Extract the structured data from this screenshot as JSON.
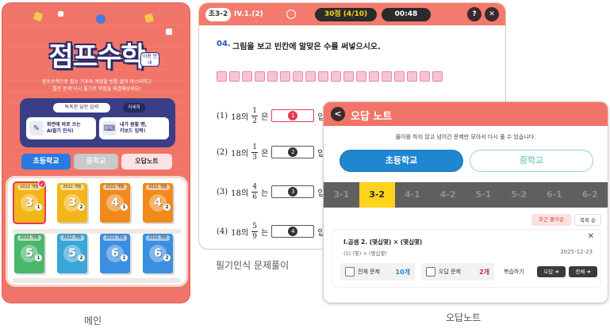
{
  "main": {
    "logo_text": "점프수학",
    "logo_badge": "이용 안내",
    "intro_line1": "점프수학으로 필수 기초와 개념을 빈틈 없이 마스터하고",
    "intro_line2": "틀린 문제 다시 풀기로 약점을 해결해보세요!",
    "input_title": "똑똑한 답안 입력",
    "detail_label": "자세히",
    "features": [
      {
        "line1": "화면에 바로 쓰는",
        "line2": "AI필기 인식!"
      },
      {
        "line1": "내가 원할 땐,",
        "line2": "키보드 입력!"
      }
    ],
    "tabs": {
      "elementary": "초등학교",
      "middle": "중학교",
      "wrong_note": "오답노트"
    },
    "books": [
      {
        "year": "2022 개정",
        "grade": "3",
        "sem": "1",
        "color": "#f2b619"
      },
      {
        "year": "2022 개정",
        "grade": "3",
        "sem": "2",
        "color": "#f2b619"
      },
      {
        "year": "2022 개정",
        "grade": "4",
        "sem": "1",
        "color": "#f08a1c"
      },
      {
        "year": "2022 개정",
        "grade": "4",
        "sem": "2",
        "color": "#f08a1c"
      },
      {
        "year": "2022 개정",
        "grade": "5",
        "sem": "1",
        "color": "#49b86a"
      },
      {
        "year": "2022 개정",
        "grade": "5",
        "sem": "2",
        "color": "#3aa6d8"
      },
      {
        "year": "2022 개정",
        "grade": "6",
        "sem": "1",
        "color": "#3a8fe0"
      },
      {
        "year": "2022 개정",
        "grade": "6",
        "sem": "2",
        "color": "#3a8fe0"
      }
    ],
    "caption": "메인"
  },
  "quiz": {
    "grade_chip": "초3-2",
    "unit_chip": "IV.1.(2)",
    "score_label": "30점 (4/10)",
    "timer": "00:48",
    "help_icon": "?",
    "close_icon": "✕",
    "question_number": "04.",
    "question_text": "그림을 보고 빈칸에 알맞은 수를 써넣으시오.",
    "rows": [
      {
        "label": "(1)",
        "base": "18의",
        "num": "1",
        "den": "2",
        "particle": "은",
        "box": "1",
        "trail": "입"
      },
      {
        "label": "(2)",
        "base": "18의",
        "num": "1",
        "den": "3",
        "particle": "은",
        "box": "2",
        "trail": "입"
      },
      {
        "label": "(3)",
        "base": "18의",
        "num": "4",
        "den": "6",
        "particle": "는",
        "box": "3",
        "trail": "입"
      },
      {
        "label": "(4)",
        "base": "18의",
        "num": "5",
        "den": "9",
        "particle": "는",
        "box": "4",
        "trail": "입"
      }
    ],
    "caption": "필기인식 문제풀이"
  },
  "note": {
    "back_icon": "<",
    "title": "오답 노트",
    "subtitle": "풀이를 하지 않고 넘어간 문제만 모아서 다시 풀 수 있습니다.",
    "seg_elementary": "초등학교",
    "seg_middle": "중학교",
    "grades": [
      "3-1",
      "3-2",
      "4-1",
      "4-2",
      "5-1",
      "5-2",
      "6-1",
      "6-2"
    ],
    "selected_grade": "3-2",
    "sort_recent": "최근 풀이순",
    "sort_wrong": "목록 순",
    "card": {
      "title": "Ⅰ.곱셈   2. (몇십몇) × (몇십몇)",
      "sub": "(5) (몇) × (몇십몇)",
      "date": "2025-12-23",
      "close": "✕",
      "total_label": "전체 문제",
      "total_value": "10개",
      "wrong_label": "오답 문제",
      "wrong_value": "2개",
      "review_label": "복습하기",
      "btn_wrong": "오답 ➜",
      "btn_all": "전체 ➜"
    },
    "caption": "오답노트"
  }
}
